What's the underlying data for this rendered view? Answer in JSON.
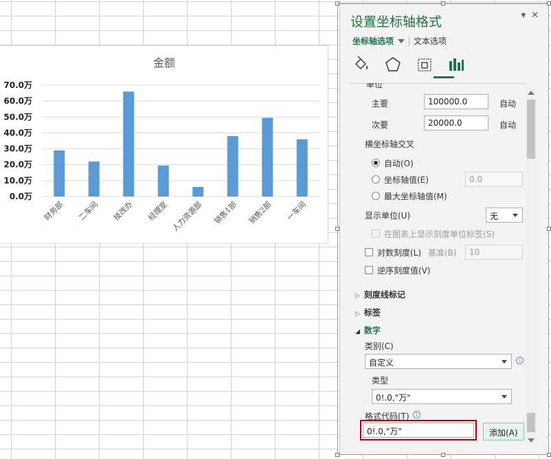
{
  "pane": {
    "title": "设置坐标轴格式",
    "tab_axis": "坐标轴选项",
    "tab_text": "文本选项",
    "icons": [
      "fill-line-icon",
      "effects-icon",
      "size-properties-icon",
      "axis-options-icon"
    ],
    "cut_label": "单位",
    "major_label": "主要",
    "major_value": "100000.0",
    "major_auto": "自动",
    "minor_label": "次要",
    "minor_value": "20000.0",
    "minor_auto": "自动",
    "cross_label": "横坐标轴交叉",
    "cross_auto": "自动(O)",
    "cross_value_label": "坐标轴值(E)",
    "cross_value": "0.0",
    "cross_max": "最大坐标轴值(M)",
    "display_units_label": "显示单位(U)",
    "display_units_value": "无",
    "show_units_label": "在图表上显示刻度单位标签(S)",
    "log_label": "对数刻度(L)",
    "base_label": "基准(B)",
    "base_value": "10",
    "reverse_label": "逆序刻度值(V)",
    "sec_ticks": "刻度线标记",
    "sec_labels": "标签",
    "sec_number": "数字",
    "category_label": "类别(C)",
    "category_value": "自定义",
    "type_label": "类型",
    "type_value": "0!.0,\"万\"",
    "format_code_label": "格式代码(T)",
    "format_code_value": "0!.0,\"万\"",
    "add_button": "添加(A)"
  },
  "colors": {
    "accent": "#217346",
    "bar": "#5b9bd5",
    "highlight": "#c00000"
  },
  "chart_data": {
    "type": "bar",
    "title": "金额",
    "categories": [
      "财务部",
      "二车间",
      "技改办",
      "经理室",
      "人力资源部",
      "销售1部",
      "销售2部",
      "一车间"
    ],
    "values": [
      29,
      22,
      66,
      19.5,
      6,
      38,
      49.5,
      36
    ],
    "value_unit": "万",
    "y_ticks": [
      "0.0万",
      "10.0万",
      "20.0万",
      "30.0万",
      "40.0万",
      "50.0万",
      "60.0万",
      "70.0万"
    ],
    "ylim": [
      0,
      70
    ],
    "grid": true,
    "legend": "none"
  }
}
